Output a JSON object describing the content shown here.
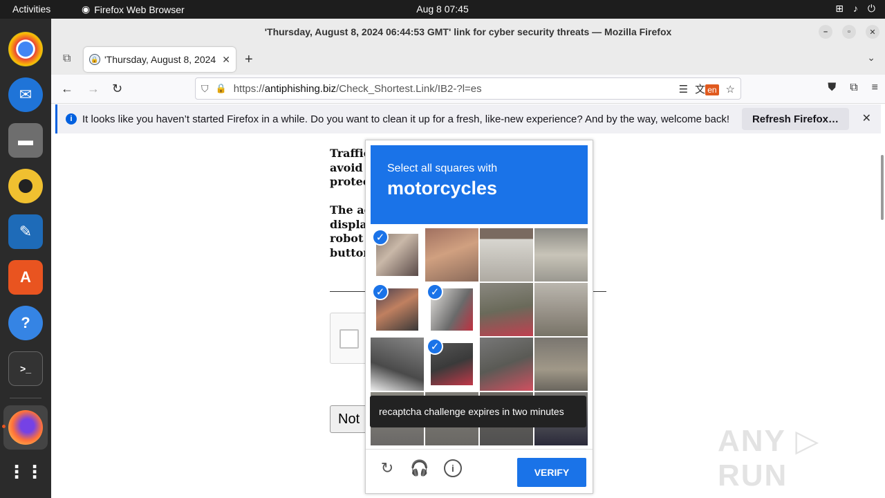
{
  "topbar": {
    "activities": "Activities",
    "app_name": "Firefox Web Browser",
    "clock": "Aug 8  07:45"
  },
  "dock": {
    "items": [
      "chrome-icon",
      "thunderbird-icon",
      "files-icon",
      "rhythmbox-icon",
      "libreoffice-writer-icon",
      "app-center-icon",
      "help-icon",
      "terminal-icon",
      "firefox-icon",
      "app-grid-icon"
    ]
  },
  "window": {
    "title": "'Thursday, August 8, 2024 06:44:53 GMT' link for cyber security threats — Mozilla Firefox"
  },
  "tab": {
    "title": "'Thursday, August 8, 2024"
  },
  "urlbar": {
    "prefix": "https://",
    "domain": "antiphishing.biz",
    "path": "/Check_Shortest.Link/IB2-?l=es",
    "translate_badge": "en"
  },
  "notification": {
    "message": "It looks like you haven’t started Firefox in a while. Do you want to clean it up for a fresh, like-new experience? And by the way, welcome back!",
    "button": "Refresh Firefox…"
  },
  "page": {
    "para1": [
      "Traffic",
      "avoid",
      "protect"
    ],
    "para2": [
      "The ac",
      "displa",
      "robot",
      "button"
    ],
    "not_button": "Not"
  },
  "captcha": {
    "instruction_small": "Select all squares with",
    "instruction_big": "motorcycles",
    "tooltip": "recaptcha challenge expires in two minutes",
    "verify": "VERIFY",
    "selected_tiles": [
      0,
      4,
      5,
      9
    ]
  },
  "watermark": "ANY RUN"
}
